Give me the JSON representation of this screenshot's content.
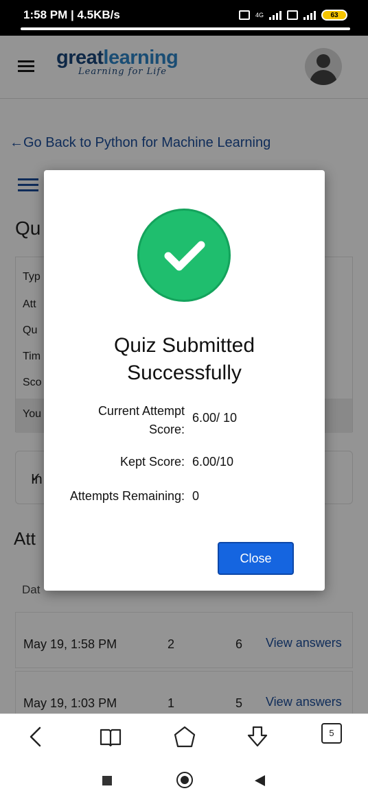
{
  "status_bar": {
    "time_speed": "1:58 PM | 4.5KB/s",
    "network": "4G",
    "battery": "63"
  },
  "header": {
    "brand_part1": "great",
    "brand_part2": "learning",
    "tagline": "Learning for Life"
  },
  "back_link": "←Go Back to Python for Machine Learning",
  "page": {
    "quiz_title_partial": "Qu",
    "info_rows": [
      "Typ",
      "Att",
      "Qu",
      "Tim",
      "Sco"
    ],
    "your_row_partial": "You",
    "instructions_partial": "In",
    "attempts_title_partial": "Att",
    "table_head_partial": "Dat"
  },
  "attempts": [
    {
      "date": "May 19, 1:58 PM",
      "attempt": "2",
      "score": "6",
      "action": "View answers"
    },
    {
      "date": "May 19, 1:03 PM",
      "attempt": "1",
      "score": "5",
      "action": "View answers"
    }
  ],
  "modal": {
    "title_line1": "Quiz Submitted",
    "title_line2": "Successfully",
    "current_attempt_label_1": "Current Attempt",
    "current_attempt_label_2": "Score:",
    "current_attempt_value": "6.00/ 10",
    "kept_label": "Kept Score:",
    "kept_value": "6.00/10",
    "remaining_label": "Attempts Remaining:",
    "remaining_value": "0",
    "close_label": "Close",
    "success_color": "#1fbe6e",
    "button_color": "#1565e0"
  },
  "browser_bar": {
    "tab_count": "5"
  }
}
